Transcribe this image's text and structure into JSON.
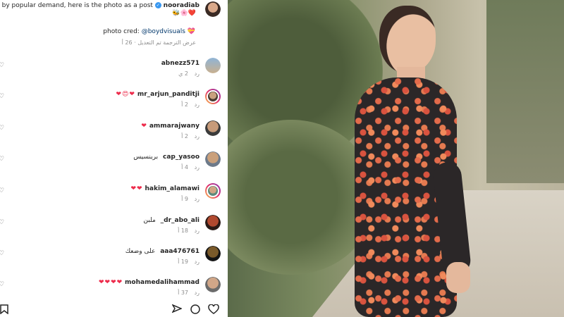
{
  "post": {
    "username": "nooradiab",
    "caption": "♡ by popular demand, here is the photo as a post",
    "caption_emoji": "🐝🌸❤️",
    "photo_cred_label": "photo cred:",
    "photo_cred_handle": "@boydvisuals",
    "edited_label": "تم التعديل · 26 أ",
    "translate_label": "عرض الترجمة"
  },
  "comments": [
    {
      "username": "abnezz571",
      "text": "",
      "emoji": "",
      "time": "2 ي",
      "reply": "رد"
    },
    {
      "username": "mr_arjun_panditji",
      "text": "",
      "emoji": "❤😍❤",
      "time": "2 أ",
      "reply": "رد"
    },
    {
      "username": "ammarajwany",
      "text": "",
      "emoji": "❤",
      "time": "2 أ",
      "reply": "رد"
    },
    {
      "username": "cap_yasoo",
      "text": "برينسيس",
      "emoji": "",
      "time": "4 أ",
      "reply": "رد"
    },
    {
      "username": "hakim_alamawi",
      "text": "",
      "emoji": "❤❤",
      "time": "9 أ",
      "reply": "رد"
    },
    {
      "username": "_dr_abo_ali",
      "text": "ملبن",
      "emoji": "",
      "time": "18 أ",
      "reply": "رد"
    },
    {
      "username": "aaa476761",
      "text": "على وضعك",
      "emoji": "",
      "time": "19 أ",
      "reply": "رد"
    },
    {
      "username": "mohamedalihammad",
      "text": "",
      "emoji": "❤❤❤❤",
      "time": "37 أ",
      "reply": "رد"
    }
  ],
  "actions": {
    "like_icon": "heart-icon",
    "comment_icon": "comment-icon",
    "share_icon": "share-icon",
    "save_icon": "bookmark-icon"
  },
  "colors": {
    "verified": "#3897f0",
    "heart": "#ed2b4b",
    "link": "#00376b",
    "muted": "#8e8e8e"
  }
}
